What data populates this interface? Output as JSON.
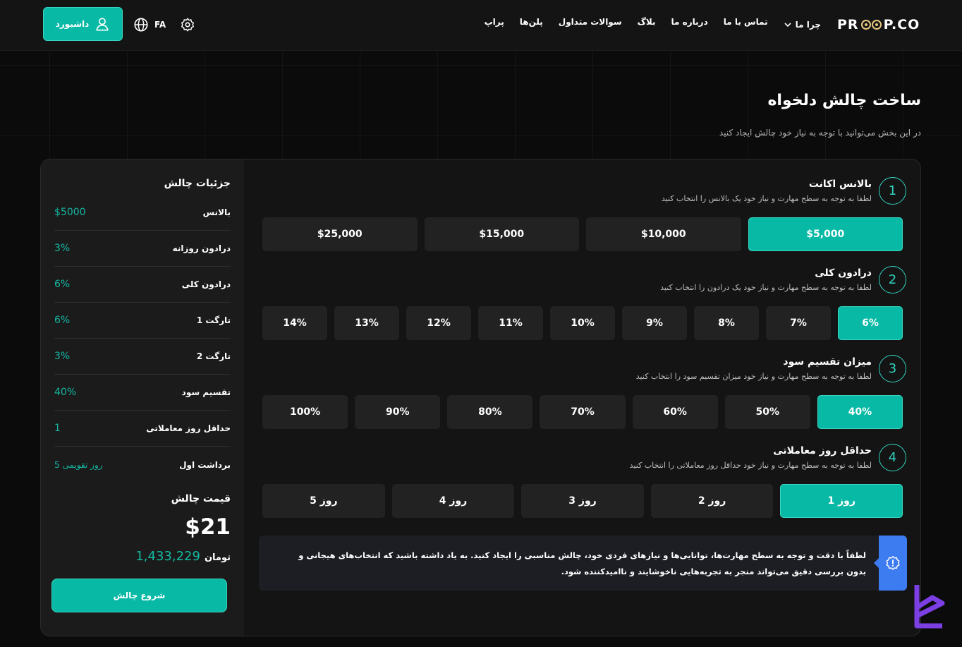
{
  "header": {
    "logo": {
      "left": "PR",
      "right": "P.CO"
    },
    "nav": [
      "پراپ",
      "پلن‌ها",
      "سوالات متداول",
      "بلاگ",
      "درباره ما",
      "تماس با ما",
      "چرا ما"
    ],
    "lang": "FA",
    "dashboard_label": "داشبورد"
  },
  "page": {
    "title": "ساخت چالش دلخواه",
    "subtitle": "در این بخش می‌توانید با توجه به نیاز خود چالش ایجاد کنید"
  },
  "steps": [
    {
      "num": "1",
      "title": "بالانس اکانت",
      "desc": "لطفا به توجه به سطح مهارت و نیاز خود یک بالانس را انتخاب کنید",
      "options": [
        "$5,000",
        "$10,000",
        "$15,000",
        "$25,000"
      ],
      "selected": 0
    },
    {
      "num": "2",
      "title": "درادون کلی",
      "desc": "لطفا به توجه به سطح مهارت و نیاز خود یک درادون را انتخاب کنید",
      "options": [
        "6%",
        "7%",
        "8%",
        "9%",
        "10%",
        "11%",
        "12%",
        "13%",
        "14%"
      ],
      "selected": 0
    },
    {
      "num": "3",
      "title": "میزان تقسیم سود",
      "desc": "لطفا به توجه به سطح مهارت و نیاز خود میزان تقسیم سود را انتخاب کنید",
      "options": [
        "40%",
        "50%",
        "60%",
        "70%",
        "80%",
        "90%",
        "100%"
      ],
      "selected": 0
    },
    {
      "num": "4",
      "title": "حداقل روز معاملاتی",
      "desc": "لطفا به توجه به سطح مهارت و نیاز خود حداقل روز معاملاتی را انتخاب کنید",
      "options": [
        "1 روز",
        "2 روز",
        "3 روز",
        "4 روز",
        "5 روز"
      ],
      "selected": 0
    }
  ],
  "notice": "لطفاً با دقت و توجه به سطح مهارت‌ها، توانایی‌ها و نیازهای فردی خود، چالش مناسبی را ایجاد کنید. به یاد داشته باشید که انتخاب‌های هیجانی و بدون بررسی دقیق می‌تواند منجر به تجربه‌هایی ناخوشایند و ناامیدکننده شود.",
  "summary": {
    "title": "جزئیات چالش",
    "rows": [
      {
        "label": "بالانس",
        "value": "$5000"
      },
      {
        "label": "درادون روزانه",
        "value": "3%"
      },
      {
        "label": "درادون کلی",
        "value": "6%"
      },
      {
        "label": "تارگت 1",
        "value": "6%"
      },
      {
        "label": "تارگت 2",
        "value": "3%"
      },
      {
        "label": "تقسیم سود",
        "value": "40%"
      },
      {
        "label": "حداقل روز معاملاتی",
        "value": "1"
      },
      {
        "label": "برداشت اول",
        "value": "5 روز تقویمی"
      }
    ],
    "price_title": "قیمت چالش",
    "price_usd": "$21",
    "price_toman": "1,433,229",
    "toman_unit": "تومان",
    "start_label": "شروع چالش"
  },
  "colors": {
    "accent": "#08b9a5",
    "info": "#3d7bf0",
    "watermark": "#7b3fe4"
  }
}
